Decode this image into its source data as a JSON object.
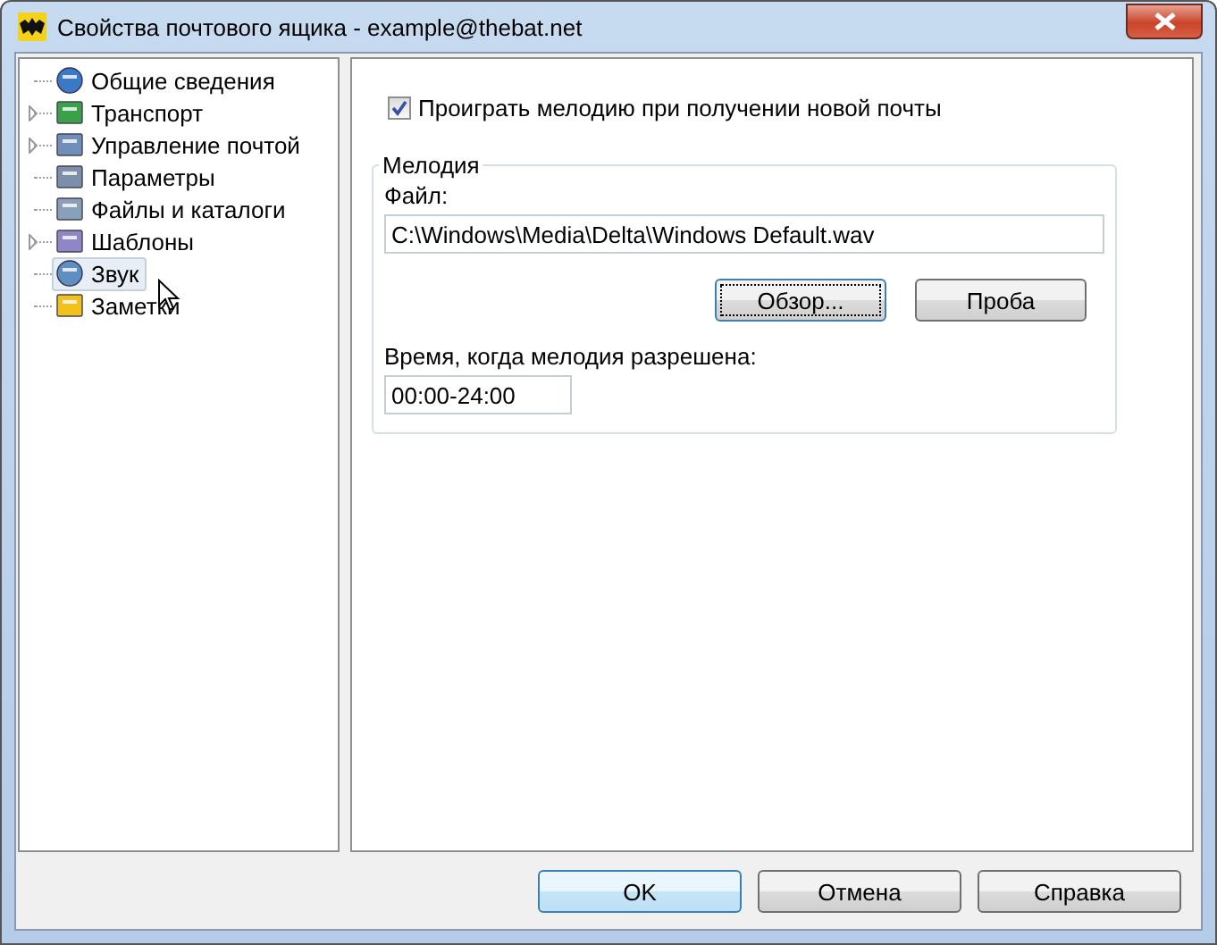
{
  "window": {
    "title": "Свойства почтового ящика - example@thebat.net"
  },
  "tree": {
    "items": [
      {
        "label": "Общие сведения",
        "expandable": false,
        "selected": false
      },
      {
        "label": "Транспорт",
        "expandable": true,
        "selected": false
      },
      {
        "label": "Управление почтой",
        "expandable": true,
        "selected": false
      },
      {
        "label": "Параметры",
        "expandable": false,
        "selected": false
      },
      {
        "label": "Файлы и каталоги",
        "expandable": false,
        "selected": false
      },
      {
        "label": "Шаблоны",
        "expandable": true,
        "selected": false
      },
      {
        "label": "Звук",
        "expandable": false,
        "selected": true
      },
      {
        "label": "Заметки",
        "expandable": false,
        "selected": false
      }
    ]
  },
  "play_checkbox": {
    "label": "Проиграть мелодию при получении новой почты",
    "checked": true
  },
  "melody_group": {
    "title": "Мелодия",
    "file_label": "Файл:",
    "file_value": "C:\\Windows\\Media\\Delta\\Windows Default.wav",
    "browse_button": "Обзор...",
    "test_button": "Проба",
    "time_label": "Время, когда мелодия разрешена:",
    "time_value": "00:00-24:00"
  },
  "buttons": [
    "OK",
    "Отмена",
    "Справка"
  ]
}
